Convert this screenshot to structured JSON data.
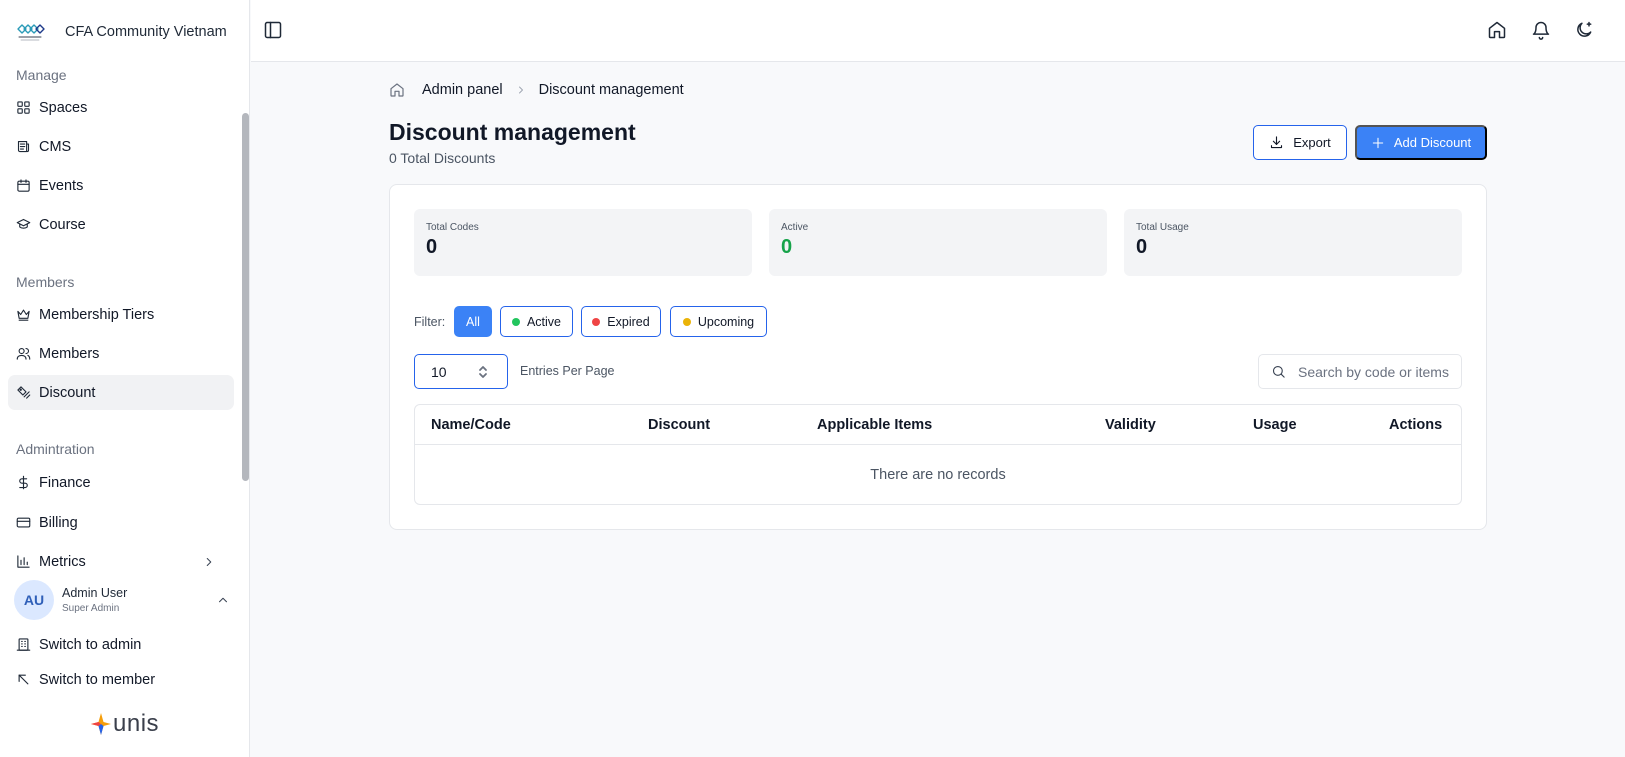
{
  "app": {
    "org_name": "CFA Community Vietnam",
    "brand_text": "unis"
  },
  "sidebar": {
    "sections": [
      {
        "label": "Manage",
        "items": [
          {
            "label": "Spaces",
            "icon": "grid-icon"
          },
          {
            "label": "CMS",
            "icon": "newspaper-icon"
          },
          {
            "label": "Events",
            "icon": "calendar-icon"
          },
          {
            "label": "Course",
            "icon": "graduation-cap-icon"
          }
        ]
      },
      {
        "label": "Members",
        "items": [
          {
            "label": "Membership Tiers",
            "icon": "crown-icon"
          },
          {
            "label": "Members",
            "icon": "users-icon"
          },
          {
            "label": "Discount",
            "icon": "discount-icon",
            "active": true
          }
        ]
      },
      {
        "label": "Admintration",
        "items": [
          {
            "label": "Finance",
            "icon": "dollar-icon"
          },
          {
            "label": "Billing",
            "icon": "credit-card-icon"
          },
          {
            "label": "Metrics",
            "icon": "chart-icon",
            "has_submenu": true
          }
        ]
      }
    ],
    "user": {
      "initials": "AU",
      "name": "Admin User",
      "role": "Super Admin"
    },
    "switch_admin": "Switch to admin",
    "switch_member": "Switch to member"
  },
  "topbar": {
    "icons": [
      "sidebar-toggle-icon",
      "home-icon",
      "bell-icon",
      "theme-toggle-icon"
    ]
  },
  "breadcrumb": {
    "parent": "Admin panel",
    "current": "Discount management"
  },
  "page": {
    "title": "Discount management",
    "subtitle": "0 Total Discounts",
    "export_label": "Export",
    "add_label": "Add Discount"
  },
  "stats": [
    {
      "label": "Total Codes",
      "value": "0",
      "color": "#111827"
    },
    {
      "label": "Active",
      "value": "0",
      "color": "#16a34a"
    },
    {
      "label": "Total Usage",
      "value": "0",
      "color": "#111827"
    }
  ],
  "filter": {
    "label": "Filter:",
    "options": [
      {
        "label": "All",
        "selected": true
      },
      {
        "label": "Active",
        "dot": "#22c55e"
      },
      {
        "label": "Expired",
        "dot": "#ef4444"
      },
      {
        "label": "Upcoming",
        "dot": "#eab308"
      }
    ]
  },
  "entries": {
    "value": "10",
    "label": "Entries Per Page"
  },
  "search": {
    "placeholder": "Search by code or items",
    "value": ""
  },
  "table": {
    "columns": [
      "Name/Code",
      "Discount",
      "Applicable Items",
      "Validity",
      "Usage",
      "Actions"
    ],
    "empty_text": "There are no records"
  },
  "colors": {
    "accent": "#3b82f6",
    "accent_border": "#2563eb"
  }
}
